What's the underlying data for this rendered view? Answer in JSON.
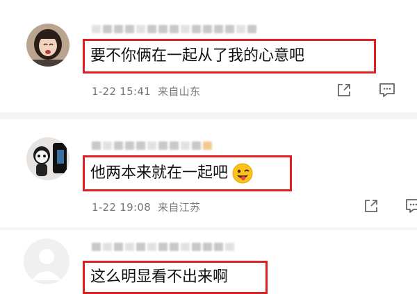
{
  "comments": [
    {
      "text": "要不你俩在一起从了我的心意吧",
      "time": "1-22 15:41",
      "location": "来自山东",
      "avatar_icon": "crying-girl-avatar"
    },
    {
      "text": "他两本来就在一起吧",
      "emoji": "winking-tongue-emoji",
      "time": "1-22 19:08",
      "location": "来自江苏",
      "avatar_icon": "panda-figure-avatar"
    },
    {
      "text": "这么明显看不出来啊",
      "avatar_icon": "default-avatar"
    }
  ],
  "actions": {
    "share_icon": "share-icon",
    "reply_icon": "reply-icon"
  },
  "colors": {
    "highlight_border": "#e02020",
    "meta_text": "#777777",
    "divider": "#f4f4f4"
  }
}
